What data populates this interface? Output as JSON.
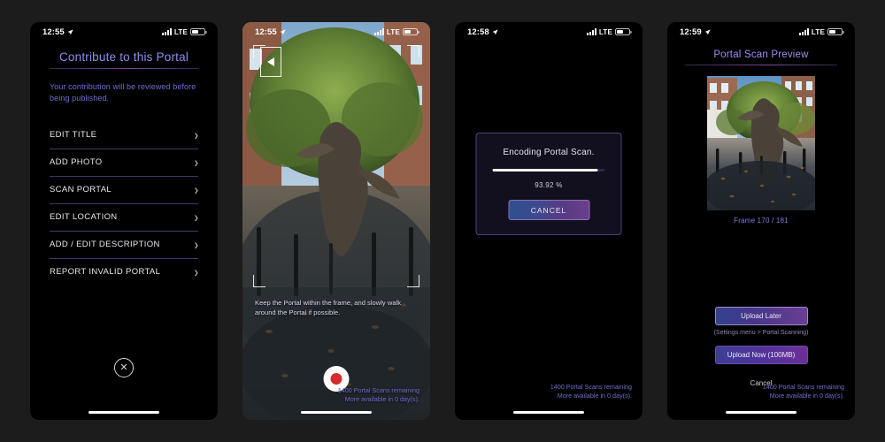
{
  "meta": {
    "background_color": "#1c1c1c",
    "app": "Ingress Portal Contribution Flow"
  },
  "screens": [
    {
      "id": "contribute",
      "statusbar": {
        "time": "12:55",
        "location_icon": "location-arrow-icon",
        "carrier": "LTE",
        "signal_icon": "signal-bars-icon",
        "battery_icon": "battery-icon"
      },
      "title": "Contribute to this Portal",
      "subtitle": "Your contribution will be reviewed before being published.",
      "menu": [
        {
          "label": "EDIT TITLE",
          "chevron": "›"
        },
        {
          "label": "ADD PHOTO",
          "chevron": "›"
        },
        {
          "label": "SCAN PORTAL",
          "chevron": "›"
        },
        {
          "label": "EDIT LOCATION",
          "chevron": "›"
        },
        {
          "label": "ADD / EDIT DESCRIPTION",
          "chevron": "›"
        },
        {
          "label": "REPORT INVALID PORTAL",
          "chevron": "›"
        }
      ],
      "close_glyph": "✕"
    },
    {
      "id": "camera-scan",
      "statusbar": {
        "time": "12:55",
        "carrier": "LTE"
      },
      "back_icon": "back-arrow-icon",
      "hint": "Keep the Portal within the frame, and slowly walk around the Portal if possible.",
      "shutter_icon": "record-button-icon",
      "scans_remaining": "1400 Portal Scans remaining",
      "scans_available": "More available in 0 day(s)."
    },
    {
      "id": "encoding",
      "statusbar": {
        "time": "12:58",
        "carrier": "LTE"
      },
      "dialog": {
        "title": "Encoding Portal Scan.",
        "percent_label": "93.92 %",
        "percent_value": 93.92,
        "cancel_label": "CANCEL"
      },
      "scans_remaining": "1400 Portal Scans remaining",
      "scans_available": "More available in 0 day(s)."
    },
    {
      "id": "scan-preview",
      "statusbar": {
        "time": "12:59",
        "carrier": "LTE"
      },
      "title": "Portal Scan Preview",
      "frame_label": "Frame 170 / 181",
      "upload_later_label": "Upload Later",
      "upload_later_sub": "(Settings menu > Portal Scanning)",
      "upload_now_label": "Upload Now (100MB)",
      "cancel_label": "Cancel",
      "scans_remaining": "1400 Portal Scans remaining",
      "scans_available": "More available in 0 day(s)."
    }
  ],
  "colors": {
    "accent_purple": "#8e8ef0",
    "accent_violet": "#6f6fd0",
    "rule_gradient_mid": "#7c4aa0",
    "record_red": "#d42b2b",
    "dialog_border": "#52427e"
  }
}
